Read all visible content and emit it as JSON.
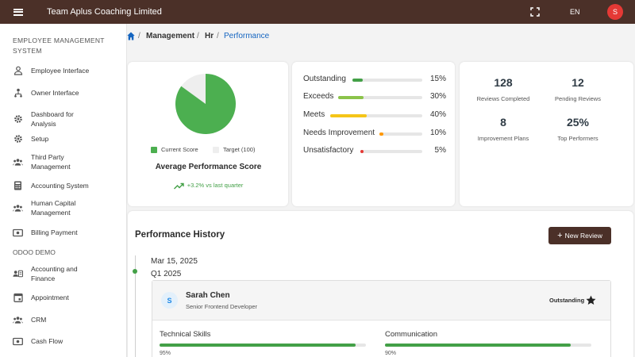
{
  "topbar": {
    "title": "Team Aplus Coaching Limited",
    "language": "EN",
    "user_initial": "S",
    "icons": [
      "menu-icon",
      "fullscreen-icon"
    ]
  },
  "sidebar": {
    "heading_line1": "EMPLOYEE MANAGEMENT",
    "heading_line2": "SYSTEM",
    "items": [
      {
        "label": "Employee Interface",
        "icon": "person-icon"
      },
      {
        "label": "Owner Interface",
        "icon": "hierarchy-icon"
      },
      {
        "label": "Dashboard for Analysis",
        "icon": "gear-icon"
      },
      {
        "label": "Setup",
        "icon": "gear-icon"
      },
      {
        "label": "Third Party Management",
        "icon": "group-icon"
      },
      {
        "label": "Accounting System",
        "icon": "calculator-icon"
      },
      {
        "label": "Human Capital Management",
        "icon": "group-icon"
      },
      {
        "label": "Billing Payment",
        "icon": "payment-icon"
      }
    ],
    "section2": "ODOO DEMO",
    "items2": [
      {
        "label": "Accounting and Finance",
        "icon": "contact-card-icon"
      },
      {
        "label": "Appointment",
        "icon": "calendar-icon"
      },
      {
        "label": "CRM",
        "icon": "group-icon"
      },
      {
        "label": "Cash Flow",
        "icon": "payment-icon"
      }
    ]
  },
  "breadcrumb": {
    "items": [
      "Management",
      "Hr",
      "Performance"
    ]
  },
  "score_card": {
    "legend_current": "Current Score",
    "legend_target": "Target (100)",
    "title": "Average Performance Score",
    "trend": "+3.2% vs last quarter",
    "current_fraction": 0.85,
    "colors": {
      "current": "#4caf50",
      "target": "#eeeeee"
    }
  },
  "distribution": [
    {
      "label": "Outstanding",
      "percent_label": "15%",
      "value": 15,
      "color": "#43a047"
    },
    {
      "label": "Exceeds",
      "percent_label": "30%",
      "value": 30,
      "color": "#8bc34a"
    },
    {
      "label": "Meets",
      "percent_label": "40%",
      "value": 40,
      "color": "#f5c518"
    },
    {
      "label": "Needs Improvement",
      "percent_label": "10%",
      "value": 10,
      "color": "#ff9800"
    },
    {
      "label": "Unsatisfactory",
      "percent_label": "5%",
      "value": 5,
      "color": "#e53935"
    }
  ],
  "stats": [
    {
      "value": "128",
      "label": "Reviews Completed"
    },
    {
      "value": "12",
      "label": "Pending Reviews"
    },
    {
      "value": "8",
      "label": "Improvement Plans"
    },
    {
      "value": "25%",
      "label": "Top Performers"
    }
  ],
  "history": {
    "title": "Performance History",
    "new_review_label": "New Review",
    "entry": {
      "date": "Mar 15, 2025",
      "quarter": "Q1 2025",
      "employee_initial": "S",
      "employee_name": "Sarah Chen",
      "employee_role": "Senior Frontend Developer",
      "rating": "Outstanding",
      "skills": [
        {
          "name": "Technical Skills",
          "value_label": "95%",
          "value": 95
        },
        {
          "name": "Communication",
          "value_label": "90%",
          "value": 90
        }
      ]
    }
  }
}
